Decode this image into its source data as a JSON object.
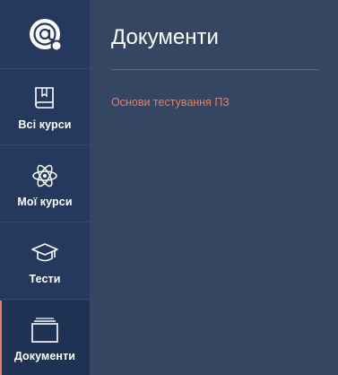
{
  "sidebar": {
    "logo_icon": "at-sign-logo-icon",
    "items": [
      {
        "label": "Всі курси",
        "icon": "book-icon",
        "active": false
      },
      {
        "label": "Мої курси",
        "icon": "atom-icon",
        "active": false
      },
      {
        "label": "Тести",
        "icon": "graduation-cap-icon",
        "active": false
      },
      {
        "label": "Документи",
        "icon": "documents-stack-icon",
        "active": true
      }
    ]
  },
  "main": {
    "title": "Документи",
    "documents": [
      {
        "label": "Основи тестування ПЗ"
      }
    ]
  },
  "colors": {
    "sidebar_bg": "#24395d",
    "main_bg": "#344662",
    "accent": "#ef7b5c",
    "text": "#ffffff"
  }
}
